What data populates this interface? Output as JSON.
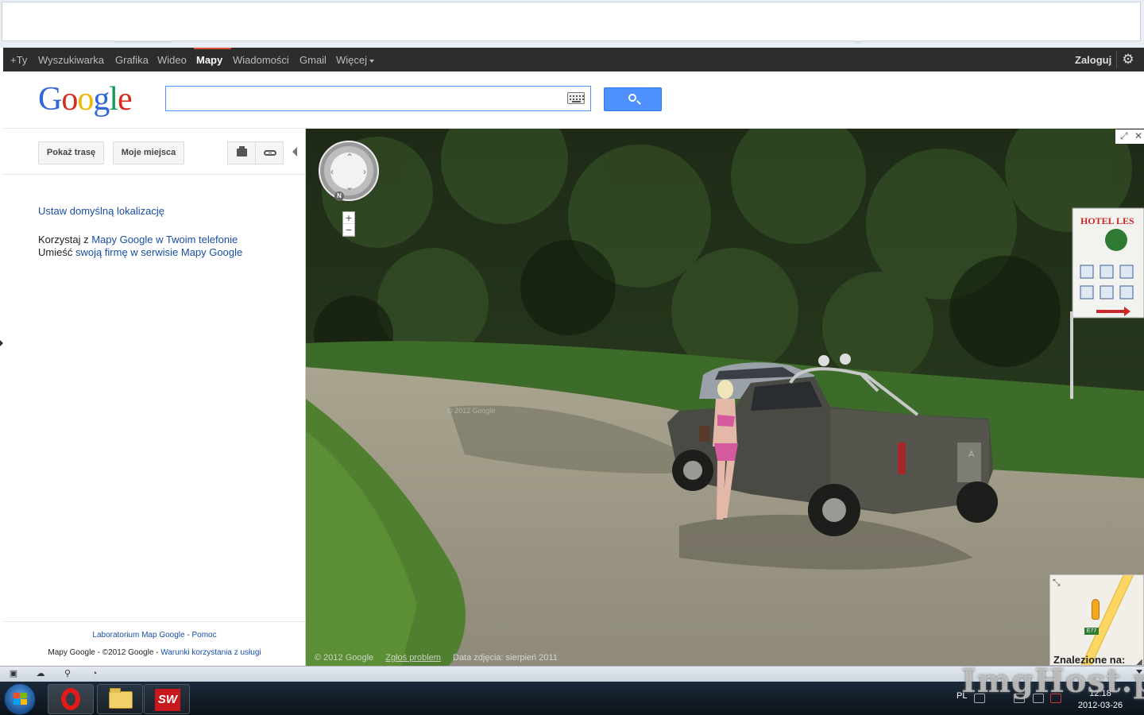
{
  "gbar": {
    "items": [
      "+Ty",
      "Wyszukiwarka",
      "Grafika",
      "Wideo",
      "Mapy",
      "Wiadomości",
      "Gmail",
      "Więcej"
    ],
    "active": "Mapy",
    "signin": "Zaloguj",
    "accent_color": "#dd4b39"
  },
  "header": {
    "logo": [
      "G",
      "o",
      "o",
      "g",
      "l",
      "e"
    ],
    "search": {
      "value": "",
      "placeholder": ""
    }
  },
  "panel": {
    "route_button": "Pokaż trasę",
    "places_button": "Moje miejsca",
    "default_location_link": "Ustaw domyślną lokalizację",
    "phone_prefix": "Korzystaj z ",
    "phone_link": "Mapy Google w Twoim telefonie",
    "business_prefix": "Umieść ",
    "business_link": "swoją firmę w serwisie Mapy Google",
    "footer_labs": "Laboratorium Map Google",
    "footer_sep": " - ",
    "footer_help": "Pomoc",
    "footer_copyright": "Mapy Google - ©2012 Google - ",
    "footer_terms": "Warunki korzystania z usługi"
  },
  "streetview": {
    "copyright": "© 2012 Google",
    "report": "Zgłoś problem",
    "date": "Data zdjęcia: sierpień 2011",
    "image_watermark": "© 2012 Google",
    "compass_label": "N",
    "zoom_in": "+",
    "zoom_out": "−",
    "sign_text": "HOTEL LES",
    "plate_letter": "A"
  },
  "minimap": {
    "label": "Znalezione na:",
    "road_badge": "E77"
  },
  "taskbar": {
    "language": "PL",
    "time": "12:18",
    "date": "2012-03-26",
    "sw_label": "SW"
  },
  "overlay_watermark": "ImgHost.pl"
}
